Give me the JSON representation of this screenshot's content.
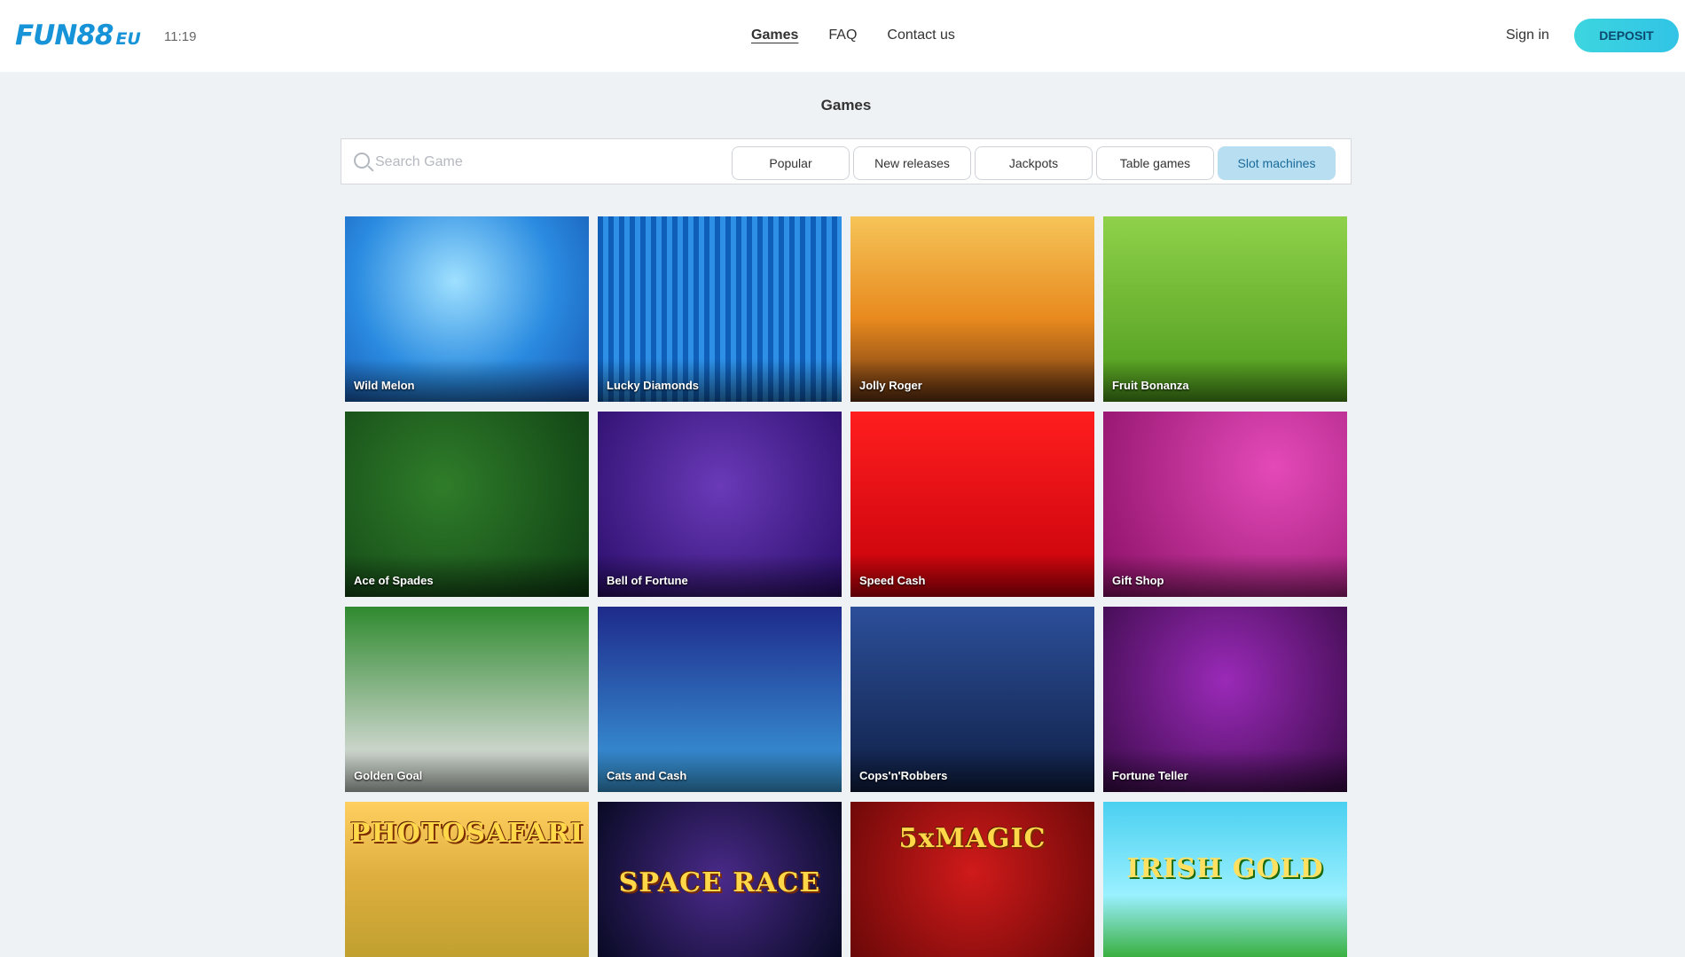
{
  "header": {
    "logo_main": "FUN88",
    "logo_suffix": "EU",
    "clock": "11:19",
    "nav": [
      {
        "label": "Games",
        "active": true
      },
      {
        "label": "FAQ",
        "active": false
      },
      {
        "label": "Contact us",
        "active": false
      }
    ],
    "signin_label": "Sign in",
    "deposit_label": "DEPOSIT"
  },
  "page": {
    "title": "Games"
  },
  "filters": {
    "search_placeholder": "Search Game",
    "search_icon": "search-icon",
    "categories": [
      {
        "label": "Popular",
        "active": false
      },
      {
        "label": "New releases",
        "active": false
      },
      {
        "label": "Jackpots",
        "active": false
      },
      {
        "label": "Table games",
        "active": false
      },
      {
        "label": "Slot machines",
        "active": true
      }
    ]
  },
  "games": [
    {
      "name": "Wild Melon"
    },
    {
      "name": "Lucky Diamonds"
    },
    {
      "name": "Jolly Roger"
    },
    {
      "name": "Fruit Bonanza"
    },
    {
      "name": "Ace of Spades"
    },
    {
      "name": "Bell of Fortune"
    },
    {
      "name": "Speed Cash"
    },
    {
      "name": "Gift Shop"
    },
    {
      "name": "Golden Goal"
    },
    {
      "name": "Cats and Cash"
    },
    {
      "name": "Cops'n'Robbers"
    },
    {
      "name": "Fortune Teller"
    },
    {
      "name": "",
      "logo": "PHOTOSAFARI"
    },
    {
      "name": "",
      "logo": "SPACE RACE"
    },
    {
      "name": "",
      "logo": "5xMAGIC"
    },
    {
      "name": "",
      "logo": "IRISH GOLD"
    }
  ],
  "colors": {
    "brand": "#1793d8",
    "deposit_gradient_start": "#3dd5df",
    "deposit_gradient_end": "#31c4e6",
    "active_chip": "#b8def2",
    "page_background": "#eff2f5"
  }
}
